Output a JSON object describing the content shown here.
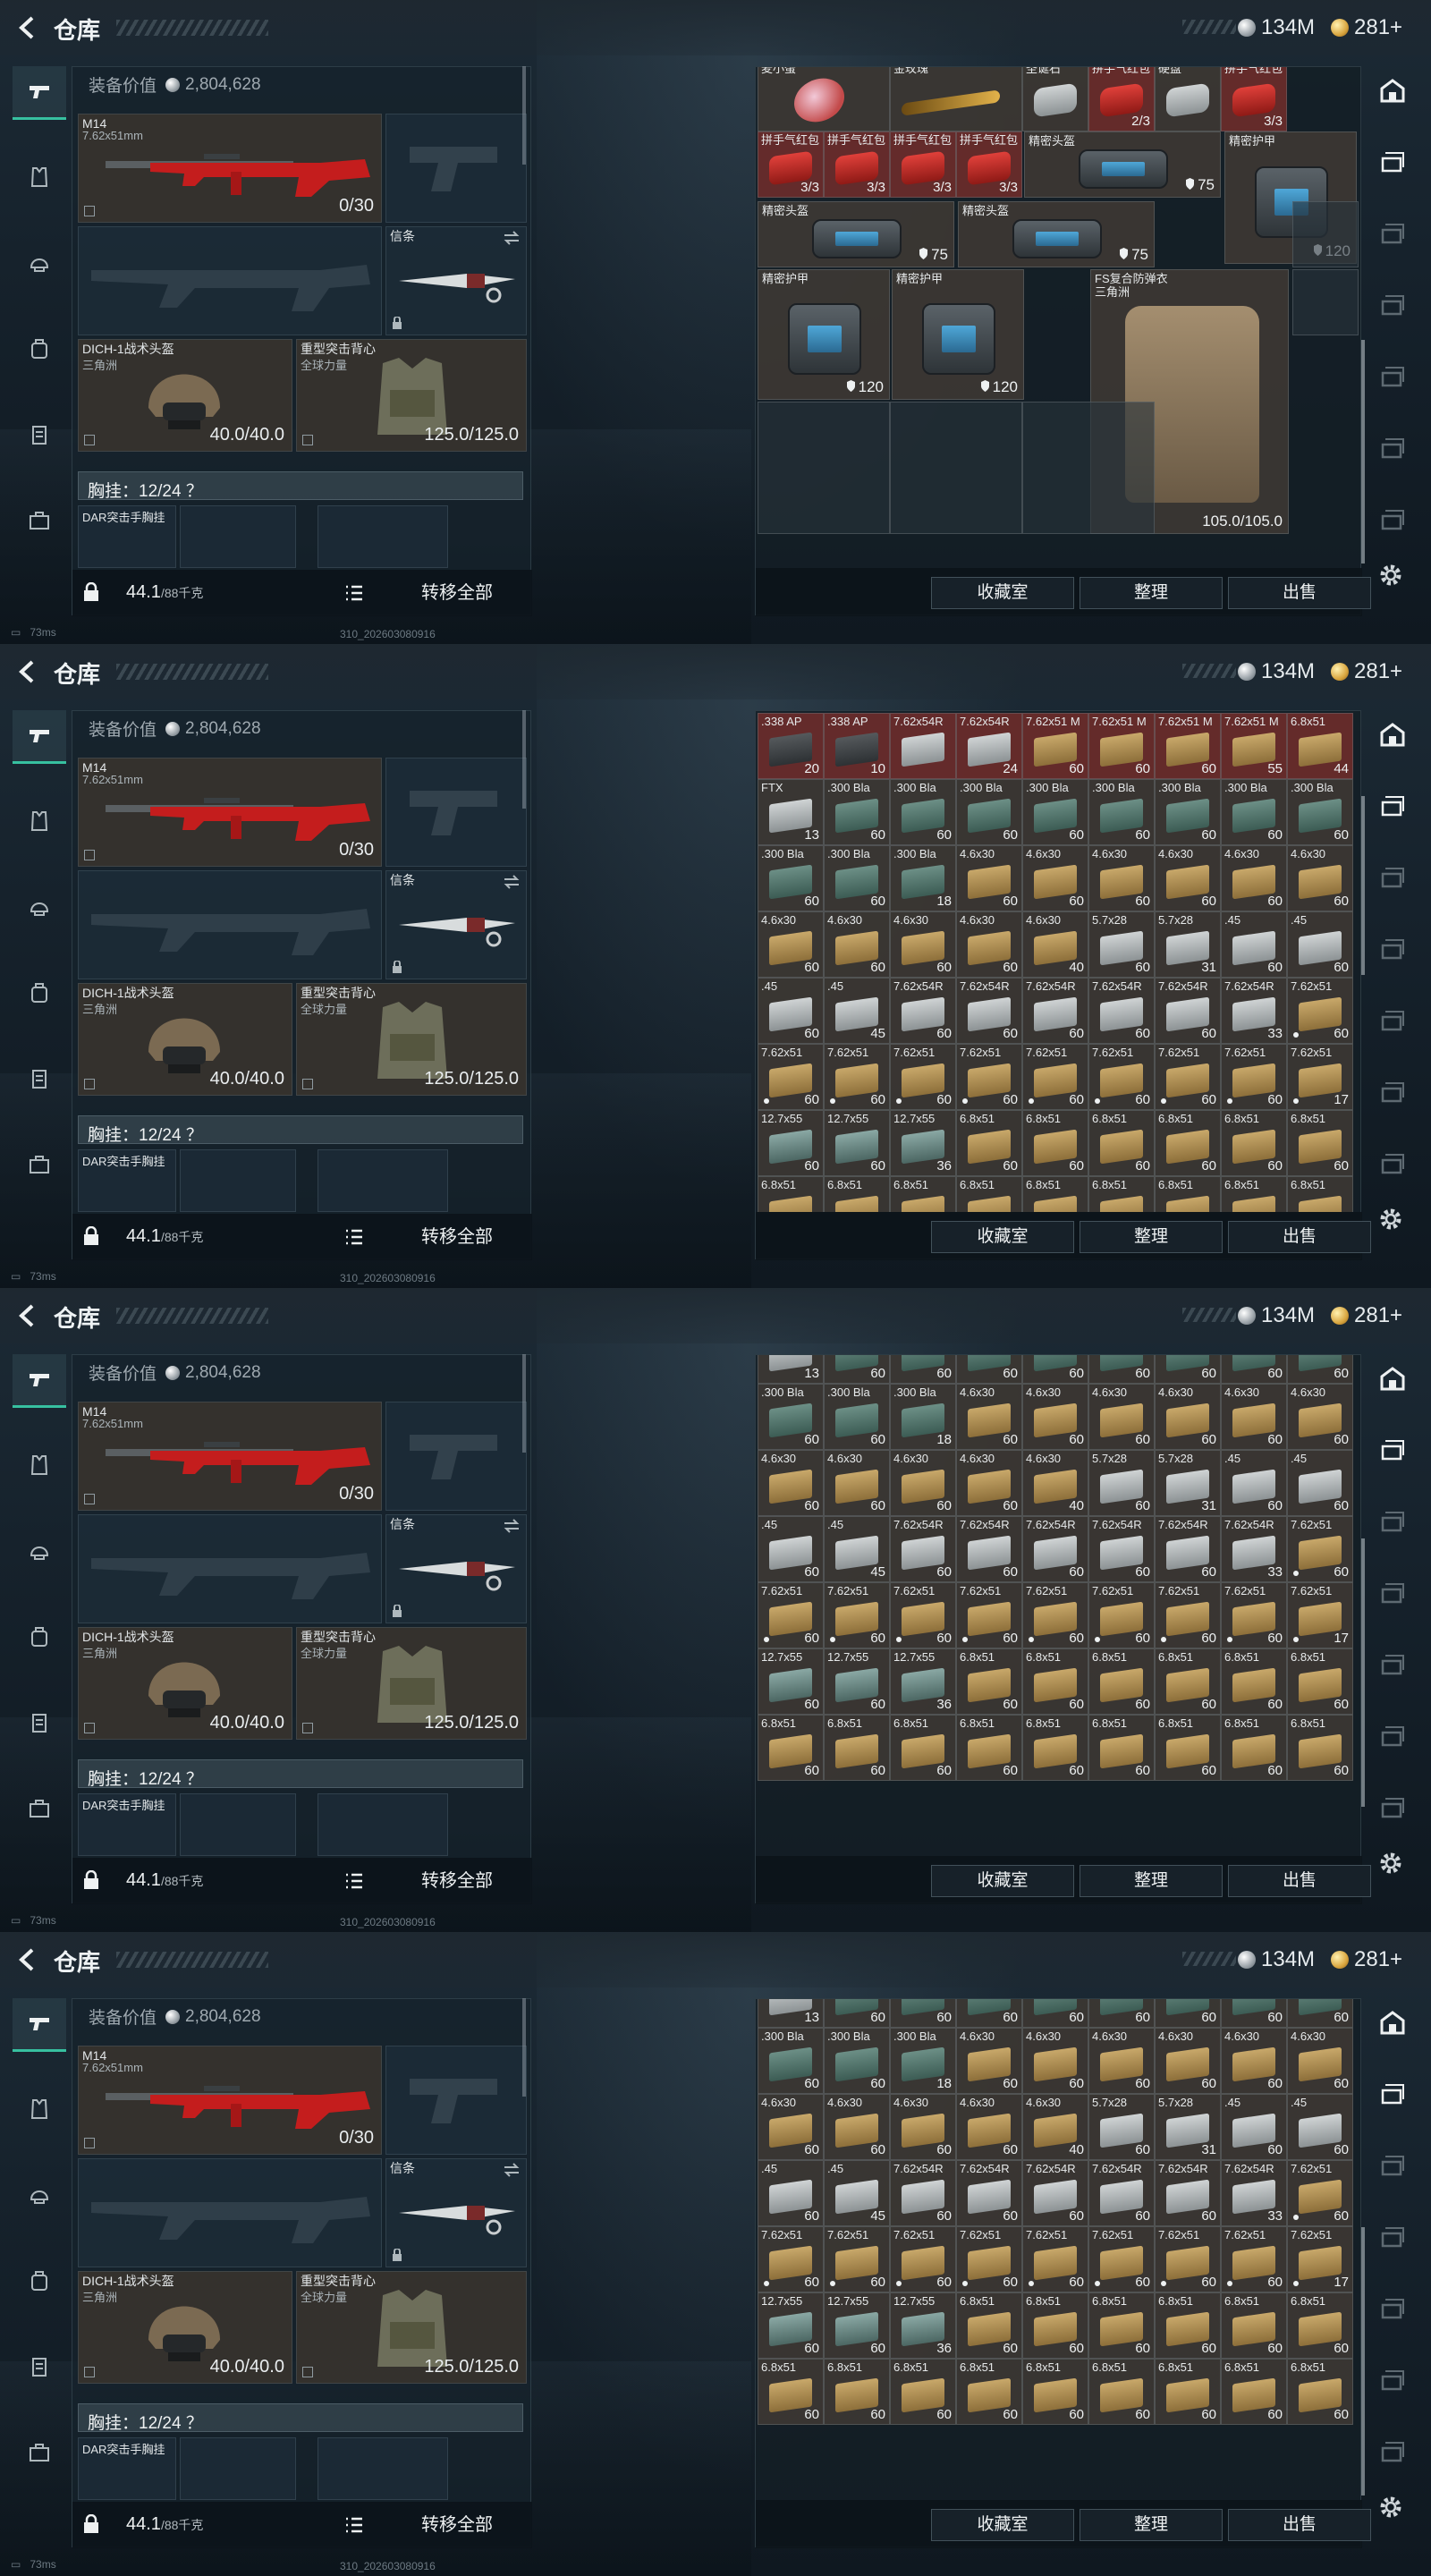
{
  "title": "仓库",
  "currency": {
    "silver": "134M",
    "gold": "281+"
  },
  "loadout": {
    "equipment_value_label": "装备价值",
    "equipment_value": "2,804,628",
    "primary": {
      "name": "M14",
      "caliber": "7.62x51mm",
      "ammo": "0/30"
    },
    "melee": {
      "name": "信条"
    },
    "helmet": {
      "name": "DICH-1战术头盔",
      "faction": "三角洲",
      "durability": "40.0/40.0"
    },
    "armor": {
      "name": "重型突击背心",
      "faction": "全球力量",
      "durability": "125.0/125.0"
    },
    "chest_rig": "胸挂：12/24 ？",
    "chest_rig_item": "DAR突击手胸挂",
    "weight": "44.1",
    "weight_max": "/88千克",
    "transfer_all": "转移全部"
  },
  "status": {
    "ping": "73ms",
    "build": "310_202603080916"
  },
  "storage": {
    "buttons": {
      "collection": "收藏室",
      "sort": "整理",
      "sell": "出售"
    },
    "view1": {
      "row1": [
        {
          "name": "麦小蛋",
          "count": ""
        },
        {
          "name": "金玫瑰",
          "count": ""
        },
        {
          "name": "圣诞石",
          "count": ""
        },
        {
          "name": "拼手气红包",
          "count": "2/3"
        },
        {
          "name": "硬盘",
          "count": ""
        },
        {
          "name": "拼手气红包",
          "count": "3/3"
        }
      ],
      "row2": [
        {
          "name": "拼手气红包",
          "count": "3/3"
        },
        {
          "name": "拼手气红包",
          "count": "3/3"
        },
        {
          "name": "拼手气红包",
          "count": "3/3"
        },
        {
          "name": "拼手气红包",
          "count": "3/3"
        }
      ],
      "box_items": [
        {
          "name": "精密头盔",
          "durability": "75"
        },
        {
          "name": "精密护甲",
          "durability": "120"
        },
        {
          "name": "精密头盔",
          "durability": "75"
        },
        {
          "name": "精密头盔",
          "durability": "75"
        },
        {
          "name": "精密护甲",
          "durability": "120"
        },
        {
          "name": "精密护甲",
          "durability": "120"
        },
        {
          "name": "精密护甲",
          "durability": "120"
        }
      ],
      "vest": {
        "name": "FS复合防弹衣",
        "faction": "三角洲",
        "durability": "105.0/105.0"
      }
    },
    "ammo_rows": [
      [
        {
          "n": ".338 AP",
          "c": "20",
          "k": "dark",
          "r": 1
        },
        {
          "n": ".338 AP",
          "c": "10",
          "k": "dark",
          "r": 1
        },
        {
          "n": "7.62x54R",
          "c": "",
          "k": "silver",
          "r": 1
        },
        {
          "n": "7.62x54R",
          "c": "24",
          "k": "silver",
          "r": 1
        },
        {
          "n": "7.62x51 M",
          "c": "60",
          "k": "tan",
          "r": 1
        },
        {
          "n": "7.62x51 M",
          "c": "60",
          "k": "tan",
          "r": 1
        },
        {
          "n": "7.62x51 M",
          "c": "60",
          "k": "tan",
          "r": 1
        },
        {
          "n": "7.62x51 M",
          "c": "55",
          "k": "tan",
          "r": 1
        },
        {
          "n": "6.8x51",
          "c": "44",
          "k": "tan",
          "r": 1
        }
      ],
      [
        {
          "n": "FTX",
          "c": "13",
          "k": "silver"
        },
        {
          "n": ".300 Bla",
          "c": "60",
          "k": "green"
        },
        {
          "n": ".300 Bla",
          "c": "60",
          "k": "green"
        },
        {
          "n": ".300 Bla",
          "c": "60",
          "k": "green"
        },
        {
          "n": ".300 Bla",
          "c": "60",
          "k": "green"
        },
        {
          "n": ".300 Bla",
          "c": "60",
          "k": "green"
        },
        {
          "n": ".300 Bla",
          "c": "60",
          "k": "green"
        },
        {
          "n": ".300 Bla",
          "c": "60",
          "k": "green"
        },
        {
          "n": ".300 Bla",
          "c": "60",
          "k": "green"
        }
      ],
      [
        {
          "n": ".300 Bla",
          "c": "60",
          "k": "green"
        },
        {
          "n": ".300 Bla",
          "c": "60",
          "k": "green"
        },
        {
          "n": ".300 Bla",
          "c": "18",
          "k": "green"
        },
        {
          "n": "4.6x30",
          "c": "60",
          "k": "tan"
        },
        {
          "n": "4.6x30",
          "c": "60",
          "k": "tan"
        },
        {
          "n": "4.6x30",
          "c": "60",
          "k": "tan"
        },
        {
          "n": "4.6x30",
          "c": "60",
          "k": "tan"
        },
        {
          "n": "4.6x30",
          "c": "60",
          "k": "tan"
        },
        {
          "n": "4.6x30",
          "c": "60",
          "k": "tan"
        }
      ],
      [
        {
          "n": "4.6x30",
          "c": "60",
          "k": "tan"
        },
        {
          "n": "4.6x30",
          "c": "60",
          "k": "tan"
        },
        {
          "n": "4.6x30",
          "c": "60",
          "k": "tan"
        },
        {
          "n": "4.6x30",
          "c": "60",
          "k": "tan"
        },
        {
          "n": "4.6x30",
          "c": "40",
          "k": "tan"
        },
        {
          "n": "5.7x28",
          "c": "60",
          "k": "silver"
        },
        {
          "n": "5.7x28",
          "c": "31",
          "k": "silver"
        },
        {
          "n": ".45",
          "c": "60",
          "k": "silver"
        },
        {
          "n": ".45",
          "c": "60",
          "k": "silver"
        }
      ],
      [
        {
          "n": ".45",
          "c": "60",
          "k": "silver"
        },
        {
          "n": ".45",
          "c": "45",
          "k": "silver"
        },
        {
          "n": "7.62x54R",
          "c": "60",
          "k": "silver"
        },
        {
          "n": "7.62x54R",
          "c": "60",
          "k": "silver"
        },
        {
          "n": "7.62x54R",
          "c": "60",
          "k": "silver"
        },
        {
          "n": "7.62x54R",
          "c": "60",
          "k": "silver"
        },
        {
          "n": "7.62x54R",
          "c": "60",
          "k": "silver"
        },
        {
          "n": "7.62x54R",
          "c": "33",
          "k": "silver"
        },
        {
          "n": "7.62x51",
          "c": "60",
          "k": "tan",
          "d": 1
        }
      ],
      [
        {
          "n": "7.62x51",
          "c": "60",
          "k": "tan",
          "d": 1
        },
        {
          "n": "7.62x51",
          "c": "60",
          "k": "tan",
          "d": 1
        },
        {
          "n": "7.62x51",
          "c": "60",
          "k": "tan",
          "d": 1
        },
        {
          "n": "7.62x51",
          "c": "60",
          "k": "tan",
          "d": 1
        },
        {
          "n": "7.62x51",
          "c": "60",
          "k": "tan",
          "d": 1
        },
        {
          "n": "7.62x51",
          "c": "60",
          "k": "tan",
          "d": 1
        },
        {
          "n": "7.62x51",
          "c": "60",
          "k": "tan",
          "d": 1
        },
        {
          "n": "7.62x51",
          "c": "60",
          "k": "tan",
          "d": 1
        },
        {
          "n": "7.62x51",
          "c": "17",
          "k": "tan",
          "d": 1
        }
      ],
      [
        {
          "n": "12.7x55",
          "c": "60",
          "k": "teal"
        },
        {
          "n": "12.7x55",
          "c": "60",
          "k": "teal"
        },
        {
          "n": "12.7x55",
          "c": "36",
          "k": "teal"
        },
        {
          "n": "6.8x51",
          "c": "60",
          "k": "tan"
        },
        {
          "n": "6.8x51",
          "c": "60",
          "k": "tan"
        },
        {
          "n": "6.8x51",
          "c": "60",
          "k": "tan"
        },
        {
          "n": "6.8x51",
          "c": "60",
          "k": "tan"
        },
        {
          "n": "6.8x51",
          "c": "60",
          "k": "tan"
        },
        {
          "n": "6.8x51",
          "c": "60",
          "k": "tan"
        }
      ],
      [
        {
          "n": "6.8x51",
          "c": "60",
          "k": "tan"
        },
        {
          "n": "6.8x51",
          "c": "60",
          "k": "tan"
        },
        {
          "n": "6.8x51",
          "c": "60",
          "k": "tan"
        },
        {
          "n": "6.8x51",
          "c": "60",
          "k": "tan"
        },
        {
          "n": "6.8x51",
          "c": "60",
          "k": "tan"
        },
        {
          "n": "6.8x51",
          "c": "60",
          "k": "tan"
        },
        {
          "n": "6.8x51",
          "c": "60",
          "k": "tan"
        },
        {
          "n": "6.8x51",
          "c": "60",
          "k": "tan"
        },
        {
          "n": "6.8x51",
          "c": "60",
          "k": "tan"
        }
      ]
    ]
  },
  "icons": [
    "back-arrow-icon",
    "silver-coin-icon",
    "gold-coin-icon",
    "pistol-icon",
    "armor-icon",
    "helmet-icon",
    "backpack-icon",
    "case-icon",
    "briefcase-icon",
    "lock-icon",
    "list-icon",
    "safehouse-icon",
    "storage-tab-icon",
    "gear-icon"
  ]
}
